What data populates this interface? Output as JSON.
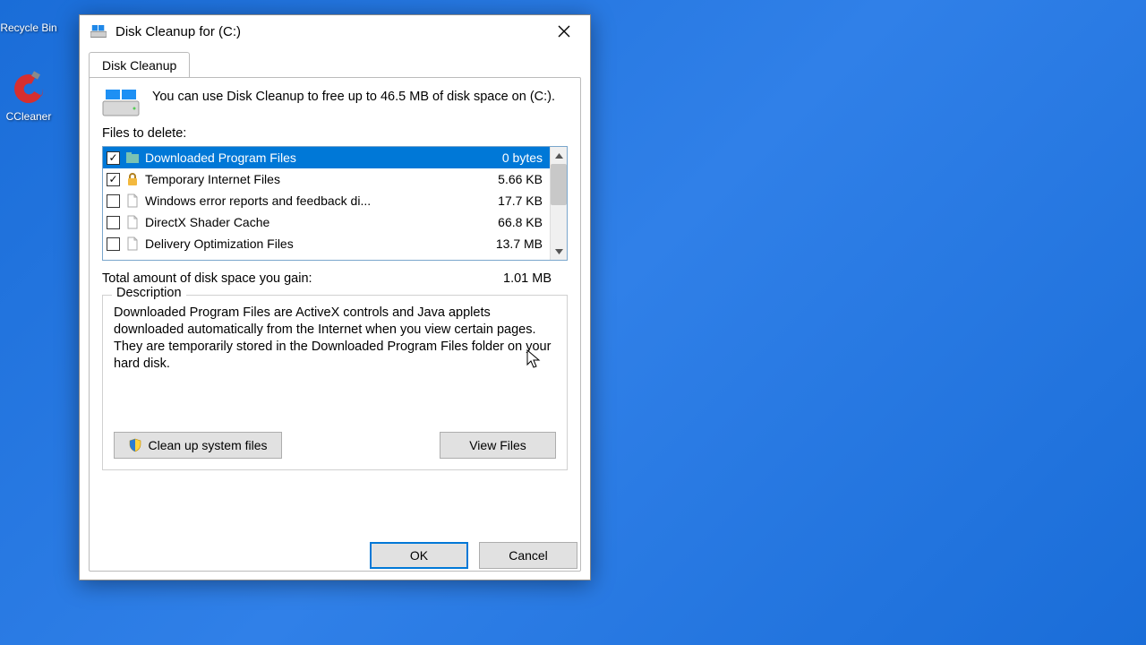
{
  "desktop": {
    "recycle_label": "Recycle Bin",
    "ccleaner_label": "CCleaner"
  },
  "dialog": {
    "title": "Disk Cleanup for  (C:)",
    "tab": "Disk Cleanup",
    "info": "You can use Disk Cleanup to free up to 46.5 MB of disk space on  (C:).",
    "files_label": "Files to delete:",
    "items": [
      {
        "checked": true,
        "name": "Downloaded Program Files",
        "size": "0 bytes",
        "selected": true,
        "icon": "folder"
      },
      {
        "checked": true,
        "name": "Temporary Internet Files",
        "size": "5.66 KB",
        "selected": false,
        "icon": "lock"
      },
      {
        "checked": false,
        "name": "Windows error reports and feedback di...",
        "size": "17.7 KB",
        "selected": false,
        "icon": "file"
      },
      {
        "checked": false,
        "name": "DirectX Shader Cache",
        "size": "66.8 KB",
        "selected": false,
        "icon": "file"
      },
      {
        "checked": false,
        "name": "Delivery Optimization Files",
        "size": "13.7 MB",
        "selected": false,
        "icon": "file"
      }
    ],
    "total_label": "Total amount of disk space you gain:",
    "total_value": "1.01 MB",
    "description_legend": "Description",
    "description_text": "Downloaded Program Files are ActiveX controls and Java applets downloaded automatically from the Internet when you view certain pages. They are temporarily stored in the Downloaded Program Files folder on your hard disk.",
    "cleanup_btn": "Clean up system files",
    "viewfiles_btn": "View Files",
    "ok_btn": "OK",
    "cancel_btn": "Cancel"
  }
}
